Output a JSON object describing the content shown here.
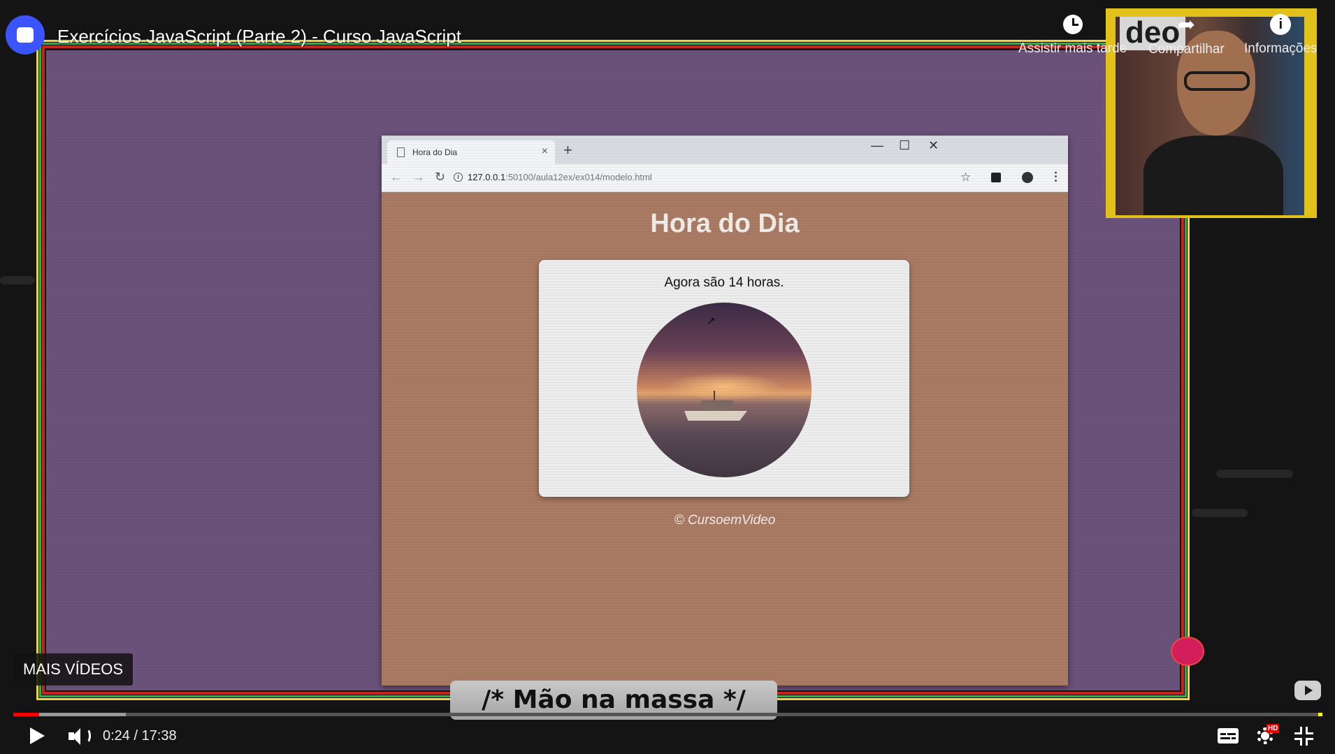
{
  "player": {
    "title": "Exercícios JavaScript (Parte 2) - Curso JavaScript",
    "actions": {
      "watch_later": "Assistir mais tarde",
      "share": "Compartilhar",
      "info": "Informações"
    },
    "more_videos": "MAIS VÍDEOS",
    "time": "0:24 / 17:38",
    "progress": {
      "played_fraction": 0.02,
      "buffered_fraction": 0.086
    },
    "settings_badge": "HD"
  },
  "slide": {
    "banner": "/* Mão na massa */",
    "webcam_sign": "deo"
  },
  "browser": {
    "tab_title": "Hora do Dia",
    "tab_close": "×",
    "new_tab": "+",
    "window": {
      "minimize": "—",
      "maximize": "☐",
      "close": "✕"
    },
    "nav": {
      "back": "←",
      "forward": "→",
      "reload": "↻"
    },
    "url_host": "127.0.0.1",
    "url_path": ":50100/aula12ex/ex014/modelo.html",
    "star": "☆",
    "menu": "⋮"
  },
  "page": {
    "heading": "Hora do Dia",
    "message": "Agora são 14 horas.",
    "footer": "© CursoemVideo"
  },
  "colors": {
    "slide_bg": "#6b527a",
    "page_bg": "#a97b64",
    "frame_yellow": "#f0d43a",
    "frame_green": "#2db33a",
    "frame_red": "#c9231d",
    "progress_red": "#ff0000"
  }
}
